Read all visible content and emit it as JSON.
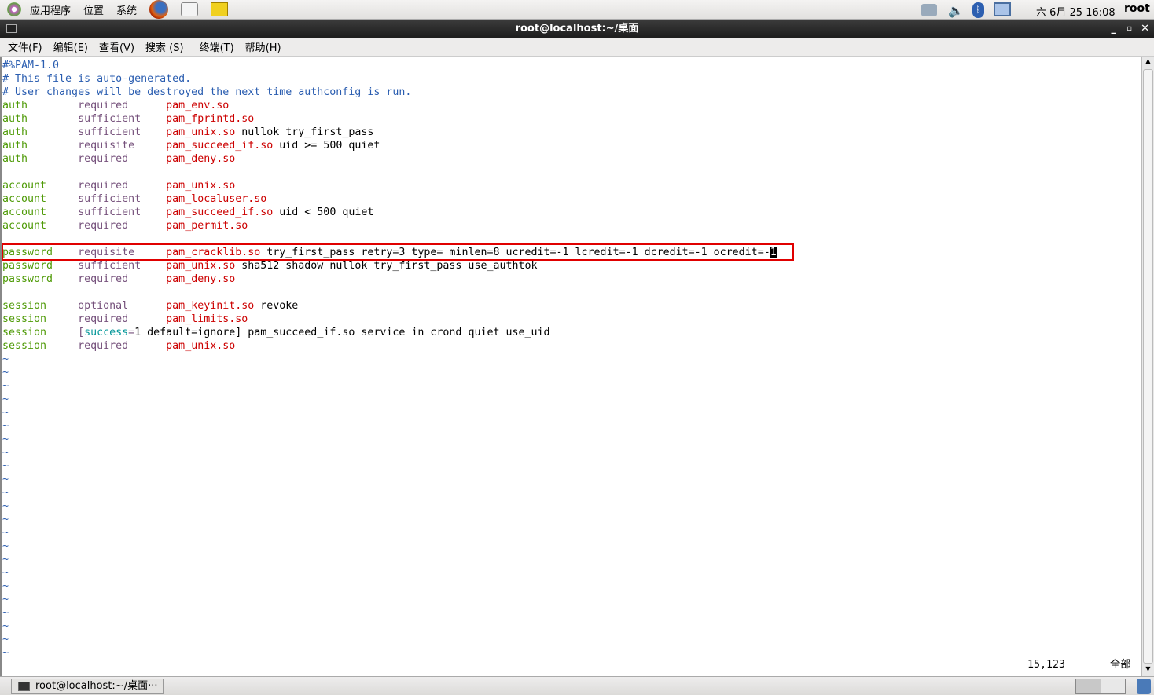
{
  "top_panel": {
    "menus": [
      "应用程序",
      "位置",
      "系统"
    ],
    "clock": "六 6月 25 16:08",
    "user": "root"
  },
  "window": {
    "title": "root@localhost:~/桌面"
  },
  "menubar": [
    "文件(F)",
    "编辑(E)",
    "查看(V)",
    "搜索 (S)",
    "终端(T)",
    "帮助(H)"
  ],
  "editor": {
    "lines": [
      [
        [
          "c",
          "#%PAM-1.0"
        ]
      ],
      [
        [
          "c",
          "# This file is auto-generated."
        ]
      ],
      [
        [
          "c",
          "# User changes will be destroyed the next time authconfig is run."
        ]
      ],
      [
        [
          "k",
          "auth"
        ],
        [
          "",
          "        "
        ],
        [
          "o",
          "required"
        ],
        [
          "",
          "      "
        ],
        [
          "m",
          "pam_env.so"
        ]
      ],
      [
        [
          "k",
          "auth"
        ],
        [
          "",
          "        "
        ],
        [
          "o",
          "sufficient"
        ],
        [
          "",
          "    "
        ],
        [
          "m",
          "pam_fprintd.so"
        ]
      ],
      [
        [
          "k",
          "auth"
        ],
        [
          "",
          "        "
        ],
        [
          "o",
          "sufficient"
        ],
        [
          "",
          "    "
        ],
        [
          "m",
          "pam_unix.so"
        ],
        [
          "",
          " nullok try_first_pass"
        ]
      ],
      [
        [
          "k",
          "auth"
        ],
        [
          "",
          "        "
        ],
        [
          "o",
          "requisite"
        ],
        [
          "",
          "     "
        ],
        [
          "m",
          "pam_succeed_if.so"
        ],
        [
          "",
          " uid >= 500 quiet"
        ]
      ],
      [
        [
          "k",
          "auth"
        ],
        [
          "",
          "        "
        ],
        [
          "o",
          "required"
        ],
        [
          "",
          "      "
        ],
        [
          "m",
          "pam_deny.so"
        ]
      ],
      [],
      [
        [
          "k",
          "account"
        ],
        [
          "",
          "     "
        ],
        [
          "o",
          "required"
        ],
        [
          "",
          "      "
        ],
        [
          "m",
          "pam_unix.so"
        ]
      ],
      [
        [
          "k",
          "account"
        ],
        [
          "",
          "     "
        ],
        [
          "o",
          "sufficient"
        ],
        [
          "",
          "    "
        ],
        [
          "m",
          "pam_localuser.so"
        ]
      ],
      [
        [
          "k",
          "account"
        ],
        [
          "",
          "     "
        ],
        [
          "o",
          "sufficient"
        ],
        [
          "",
          "    "
        ],
        [
          "m",
          "pam_succeed_if.so"
        ],
        [
          "",
          " uid < 500 quiet"
        ]
      ],
      [
        [
          "k",
          "account"
        ],
        [
          "",
          "     "
        ],
        [
          "o",
          "required"
        ],
        [
          "",
          "      "
        ],
        [
          "m",
          "pam_permit.so"
        ]
      ],
      [],
      [
        [
          "k",
          "password"
        ],
        [
          "",
          "    "
        ],
        [
          "o",
          "requisite"
        ],
        [
          "",
          "     "
        ],
        [
          "m",
          "pam_cracklib.so"
        ],
        [
          "",
          " try_first_pass retry=3 type= minlen=8 ucredit=-1 lcredit=-1 dcredit=-1 ocredit=-"
        ],
        [
          "cur",
          "1"
        ]
      ],
      [
        [
          "k",
          "password"
        ],
        [
          "",
          "    "
        ],
        [
          "o",
          "sufficient"
        ],
        [
          "",
          "    "
        ],
        [
          "m",
          "pam_unix.so"
        ],
        [
          "",
          " sha512 shadow nullok try_first_pass use_authtok"
        ]
      ],
      [
        [
          "k",
          "password"
        ],
        [
          "",
          "    "
        ],
        [
          "o",
          "required"
        ],
        [
          "",
          "      "
        ],
        [
          "m",
          "pam_deny.so"
        ]
      ],
      [],
      [
        [
          "k",
          "session"
        ],
        [
          "",
          "     "
        ],
        [
          "o",
          "optional"
        ],
        [
          "",
          "      "
        ],
        [
          "m",
          "pam_keyinit.so"
        ],
        [
          "",
          " revoke"
        ]
      ],
      [
        [
          "k",
          "session"
        ],
        [
          "",
          "     "
        ],
        [
          "o",
          "required"
        ],
        [
          "",
          "      "
        ],
        [
          "m",
          "pam_limits.so"
        ]
      ],
      [
        [
          "k",
          "session"
        ],
        [
          "",
          "     "
        ],
        [
          "o",
          "["
        ],
        [
          "cy",
          "success"
        ],
        [
          "o",
          "="
        ],
        [
          "",
          "1 default=ignore] pam_succeed_if.so service in crond quiet use_uid"
        ]
      ],
      [
        [
          "k",
          "session"
        ],
        [
          "",
          "     "
        ],
        [
          "o",
          "required"
        ],
        [
          "",
          "      "
        ],
        [
          "m",
          "pam_unix.so"
        ]
      ]
    ],
    "tilde": "~",
    "tilde_count": 23,
    "position": "15,123",
    "scroll_label": "全部"
  },
  "taskbar": {
    "item": "root@localhost:~/桌面···"
  }
}
